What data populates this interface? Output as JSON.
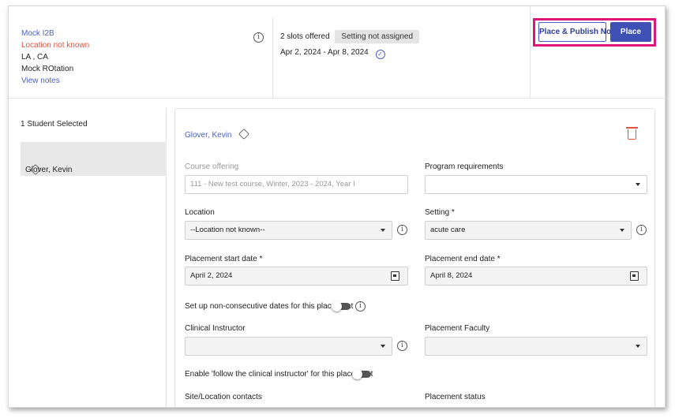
{
  "header": {
    "info": {
      "title": "Mock I2B",
      "location": "Location not known",
      "region": "LA , CA",
      "rotation": "Mock ROtation",
      "view_notes": "View notes"
    },
    "slots_offered": "2 slots offered",
    "setting_badge": "Setting not assigned",
    "date_range": "Apr 2, 2024 - Apr 8, 2024",
    "buttons": {
      "place_publish": "Place & Publish Now",
      "place": "Place"
    }
  },
  "left_panel": {
    "selected_count": "1 Student Selected",
    "students": [
      {
        "name": "Glover, Kevin"
      }
    ]
  },
  "form": {
    "student_name": "Glover, Kevin",
    "course_offering": {
      "label": "Course offering",
      "value": "111 - New test course, Winter, 2023 - 2024, Year I"
    },
    "program_requirements": {
      "label": "Program requirements",
      "value": ""
    },
    "location": {
      "label": "Location",
      "value": "--Location not known--"
    },
    "setting": {
      "label": "Setting *",
      "value": "acute care"
    },
    "start_date": {
      "label": "Placement start date *",
      "value": "April 2, 2024"
    },
    "end_date": {
      "label": "Placement end date *",
      "value": "April 8, 2024"
    },
    "non_consecutive": {
      "label": "Set up non-consecutive dates for this placement",
      "on": false
    },
    "clinical_instructor": {
      "label": "Clinical Instructor",
      "value": ""
    },
    "placement_faculty": {
      "label": "Placement Faculty",
      "value": ""
    },
    "follow_instructor": {
      "label": "Enable 'follow the clinical instructor' for this placement",
      "on": false
    },
    "site_contacts_label": "Site/Location contacts",
    "placement_status_label": "Placement status"
  },
  "colors": {
    "link": "#4a5fc1",
    "warning": "#e5533d",
    "primary": "#3f51b5",
    "highlight": "#e0157a"
  }
}
